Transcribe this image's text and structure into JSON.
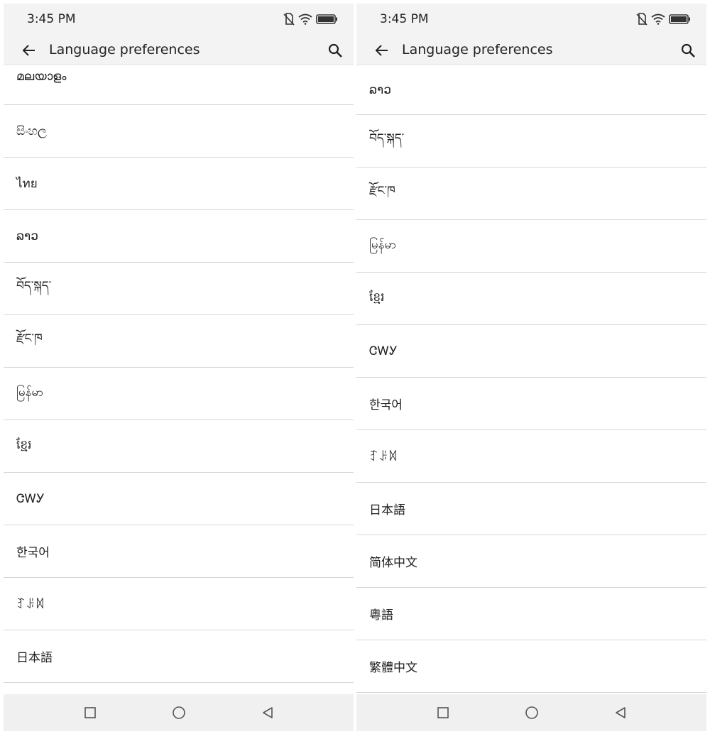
{
  "screens": [
    {
      "status": {
        "time": "3:45 PM"
      },
      "appbar": {
        "title": "Language preferences"
      },
      "languages": [
        "മലയാളം",
        "සිංහල",
        "ไทย",
        "ລາວ",
        "བོད་སྐད་",
        "རྫོང་ཁ",
        "မြန်မာ",
        "ខ្មែរ",
        "ᏣᎳᎩ",
        "한국어",
        "ꆈꌠꉙ",
        "日本語"
      ]
    },
    {
      "status": {
        "time": "3:45 PM"
      },
      "appbar": {
        "title": "Language preferences"
      },
      "languages": [
        "ລາວ",
        "བོད་སྐད་",
        "རྫོང་ཁ",
        "မြန်မာ",
        "ខ្មែរ",
        "ᏣᎳᎩ",
        "한국어",
        "ꆈꌠꉙ",
        "日本語",
        "简体中文",
        "粵語",
        "繁體中文"
      ]
    }
  ],
  "icons": {
    "status": [
      "no-sim-icon",
      "wifi-icon",
      "battery-icon"
    ],
    "appbar": [
      "back-arrow-icon",
      "search-icon"
    ],
    "navbar": [
      "recents-square-icon",
      "home-circle-icon",
      "back-triangle-icon"
    ]
  },
  "colors": {
    "bar_background": "#f3f3f3",
    "divider": "#d6d6d6",
    "text": "#222222"
  }
}
